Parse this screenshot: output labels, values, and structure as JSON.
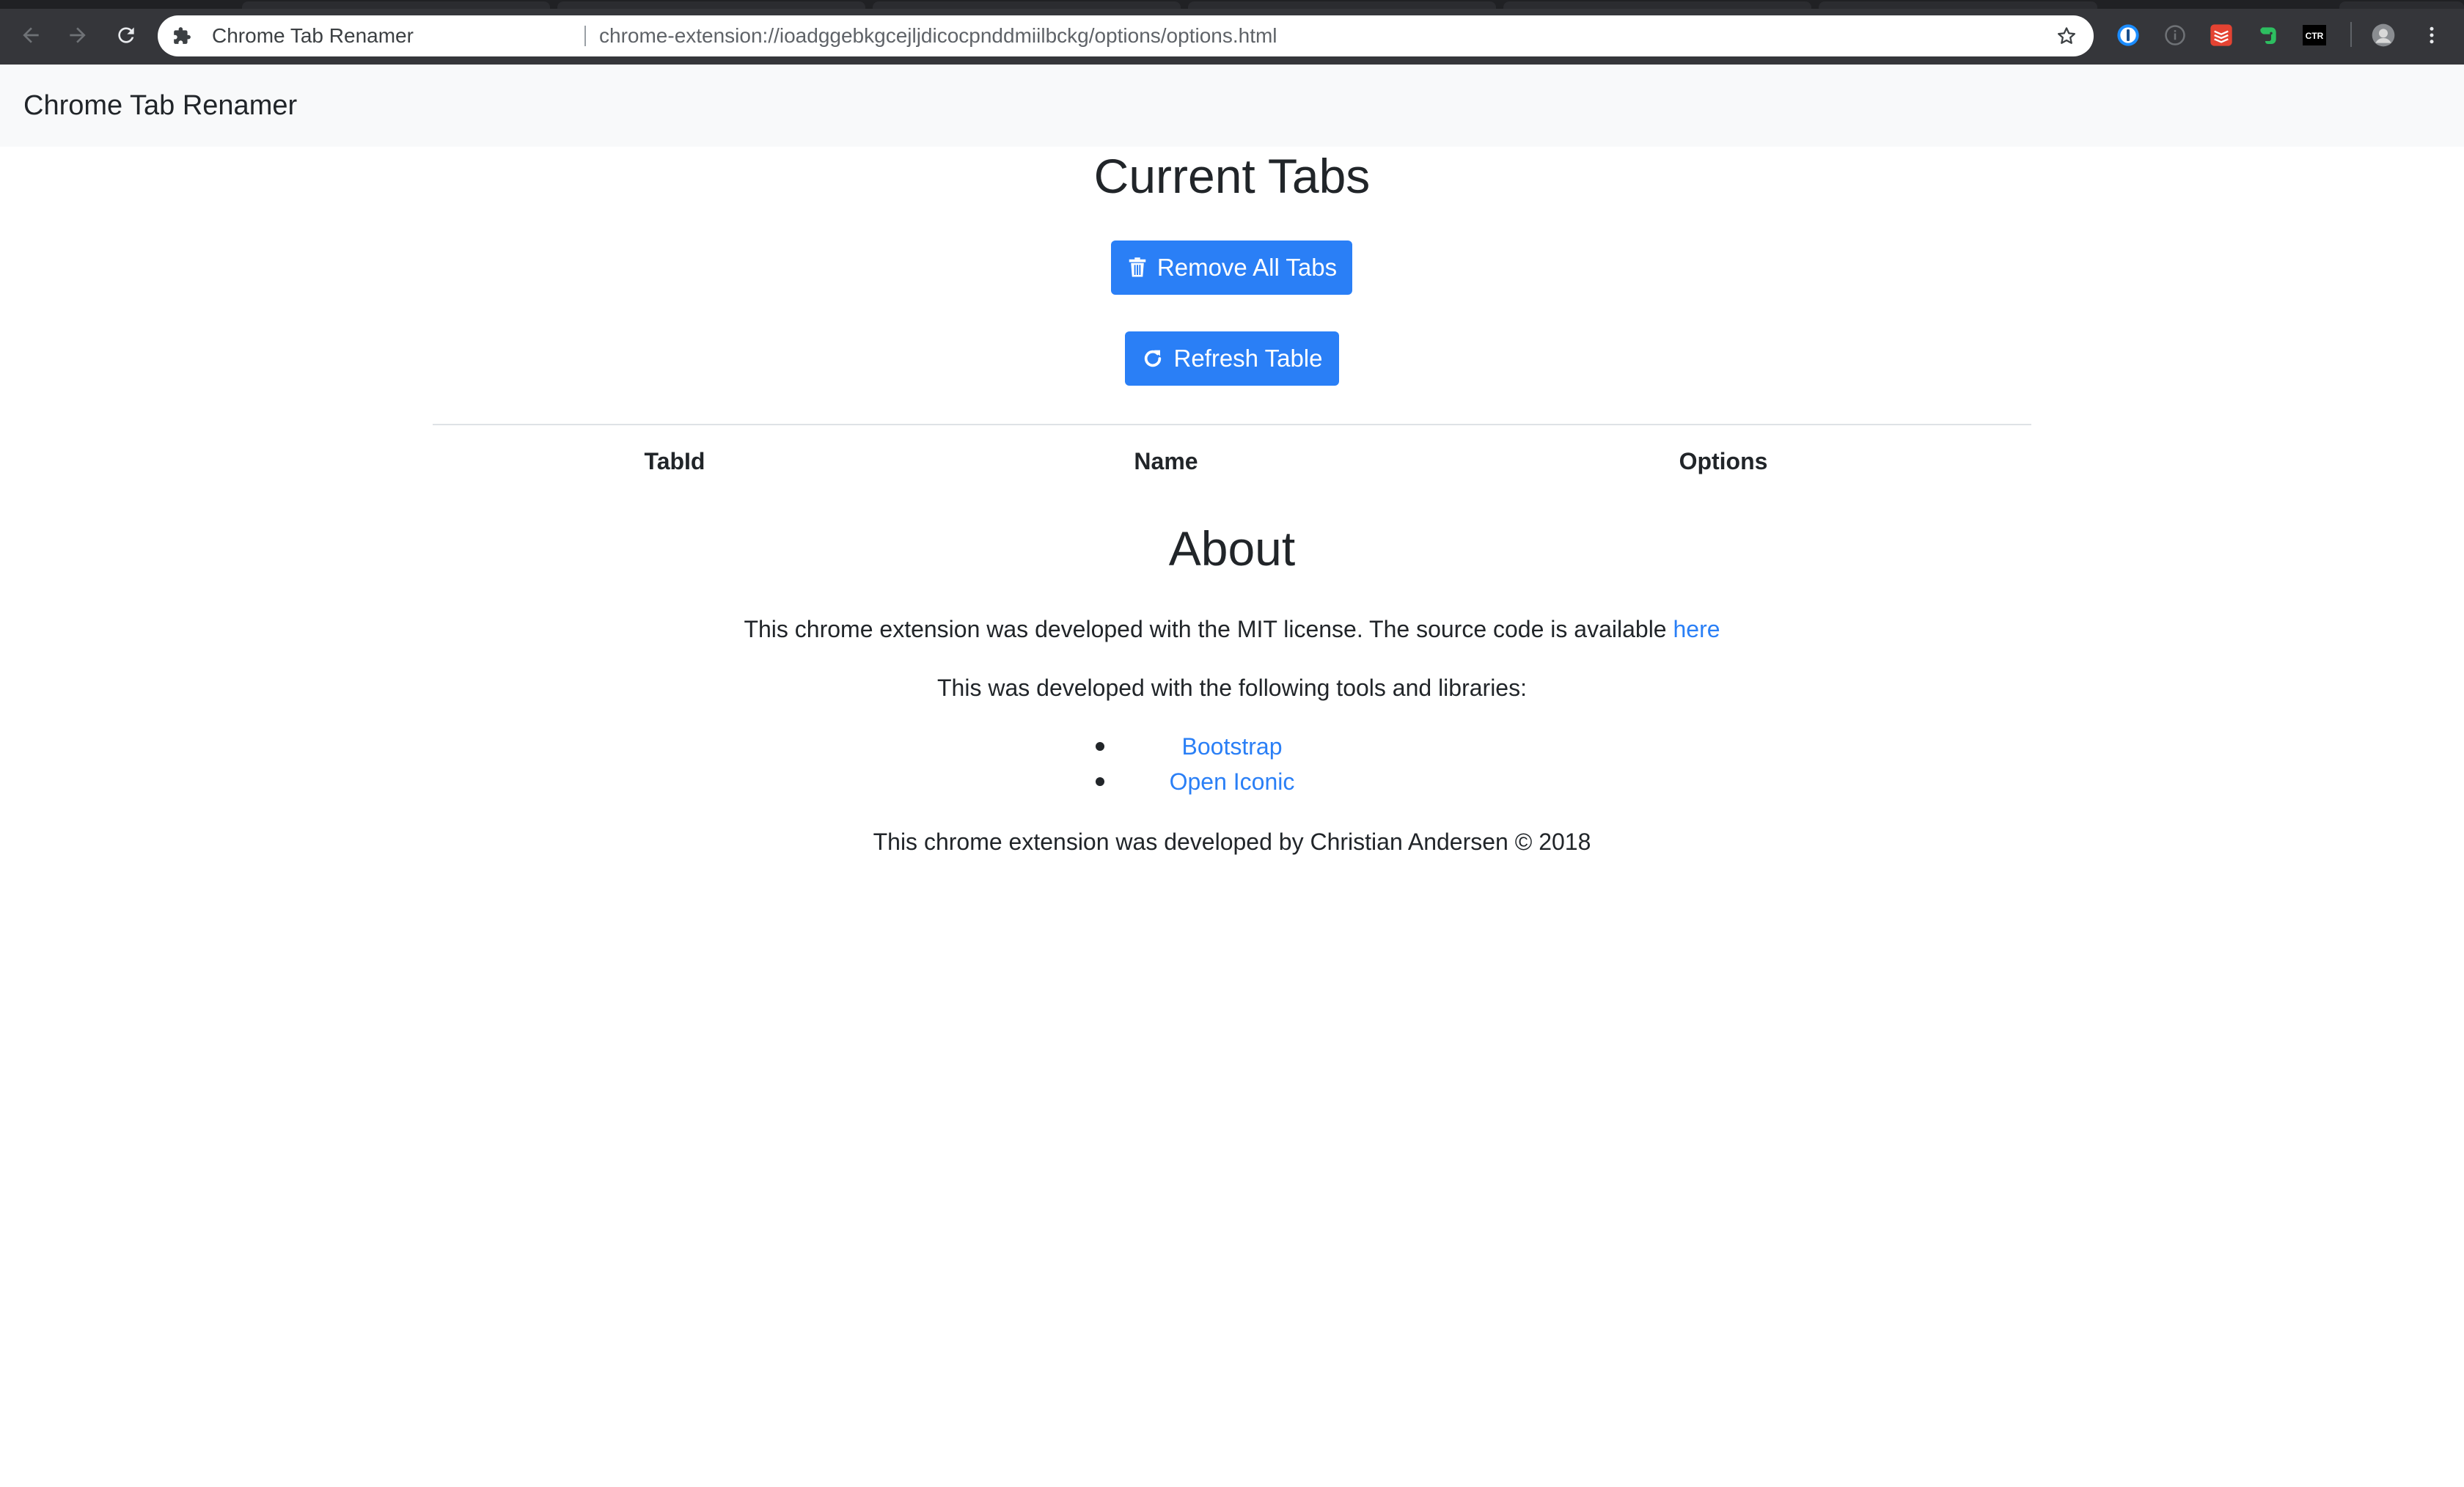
{
  "browser": {
    "tab_title": "Chrome Tab Renamer",
    "url": "chrome-extension://ioadggebkgcejljdicocpnddmiilbckg/options/options.html",
    "extensions": [
      "onepassword-icon",
      "info-icon",
      "todoist-icon",
      "evernote-icon",
      "ctr-icon"
    ],
    "ctr_label": "CTR"
  },
  "navbar": {
    "brand": "Chrome Tab Renamer"
  },
  "current_tabs": {
    "heading": "Current Tabs",
    "remove_all_label": "Remove All Tabs",
    "refresh_label": "Refresh Table",
    "columns": [
      "TabId",
      "Name",
      "Options"
    ],
    "rows": []
  },
  "about": {
    "heading": "About",
    "license_text": "This chrome extension was developed with the MIT license. The source code is available ",
    "license_link": "here",
    "tools_text": "This was developed with the following tools and libraries:",
    "libraries": [
      "Bootstrap",
      "Open Iconic"
    ],
    "footer": "This chrome extension was developed by Christian Andersen © 2018"
  },
  "colors": {
    "primary": "#2a7ff6",
    "navbar_bg": "#f8f9fa",
    "chrome_bg": "#35363a"
  }
}
